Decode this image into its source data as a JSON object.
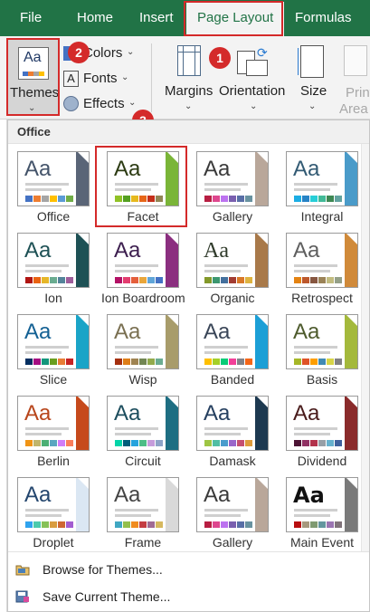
{
  "tabs": {
    "file": "File",
    "home": "Home",
    "insert": "Insert",
    "page_layout": "Page Layout",
    "formulas": "Formulas"
  },
  "ribbon": {
    "themes_label": "Themes",
    "colors_label": "Colors",
    "fonts_label": "Fonts",
    "effects_label": "Effects",
    "margins_label": "Margins",
    "orientation_label": "Orientation",
    "size_label": "Size",
    "print_label": "Print",
    "area_label": "Area",
    "themes_icon_text": "Aa"
  },
  "badges": {
    "one": "1",
    "two": "2",
    "three": "3"
  },
  "panel": {
    "section_title": "Office",
    "themes": [
      {
        "name": "Office",
        "aa_color": "#44546a",
        "aa_font": "sans",
        "accent": "#5a6577",
        "swatches": [
          "#4472c4",
          "#ed7d31",
          "#a5a5a5",
          "#ffc000",
          "#5b9bd5",
          "#70ad47"
        ]
      },
      {
        "name": "Facet",
        "aa_color": "#2c3b13",
        "aa_font": "sans",
        "accent": "#7ab538",
        "swatches": [
          "#90c226",
          "#54a021",
          "#e6b91e",
          "#e76618",
          "#c42f1a",
          "#918655"
        ]
      },
      {
        "name": "Gallery",
        "aa_color": "#3a3a3a",
        "aa_font": "sans",
        "accent": "#b9a79a",
        "swatches": [
          "#b71e42",
          "#de478e",
          "#bc72f0",
          "#795faf",
          "#586ea6",
          "#6892a0"
        ]
      },
      {
        "name": "Integral",
        "aa_color": "#335b74",
        "aa_font": "sans",
        "accent": "#4a9bc9",
        "swatches": [
          "#1cade4",
          "#2683c6",
          "#27ced7",
          "#42ba97",
          "#3e8853",
          "#62a39f"
        ]
      },
      {
        "name": "Ion",
        "aa_color": "#1e5155",
        "aa_font": "sans",
        "accent": "#1e5155",
        "swatches": [
          "#b01513",
          "#ea6312",
          "#e6b729",
          "#6aac90",
          "#54849a",
          "#9e5e9b"
        ]
      },
      {
        "name": "Ion Boardroom",
        "aa_color": "#3d1f4f",
        "aa_font": "sans",
        "accent": "#8b2f7f",
        "swatches": [
          "#b31166",
          "#e33d6f",
          "#e45f3c",
          "#e9a63b",
          "#60a5d8",
          "#4472c4"
        ]
      },
      {
        "name": "Organic",
        "aa_color": "#2f3a2a",
        "aa_font": "serif",
        "accent": "#a8794a",
        "swatches": [
          "#83992a",
          "#3c9770",
          "#44709d",
          "#a23c33",
          "#d97828",
          "#deb340"
        ]
      },
      {
        "name": "Retrospect",
        "aa_color": "#5f5f5f",
        "aa_font": "sans",
        "accent": "#d08a3a",
        "swatches": [
          "#e48312",
          "#bd582c",
          "#865640",
          "#9b8357",
          "#c2bc80",
          "#94a088"
        ]
      },
      {
        "name": "Slice",
        "aa_color": "#146194",
        "aa_font": "sans",
        "accent": "#1aa4c7",
        "swatches": [
          "#052f61",
          "#a50e82",
          "#14967c",
          "#6a9e1f",
          "#e87d37",
          "#c62324"
        ]
      },
      {
        "name": "Wisp",
        "aa_color": "#7a7052",
        "aa_font": "sans",
        "accent": "#a89c6b",
        "swatches": [
          "#a53010",
          "#de7e18",
          "#9f8351",
          "#728653",
          "#92aa4c",
          "#6aac91"
        ]
      },
      {
        "name": "Banded",
        "aa_color": "#3a4658",
        "aa_font": "sans",
        "accent": "#1c9fd6",
        "swatches": [
          "#ffc000",
          "#a5d028",
          "#08cc78",
          "#f24099",
          "#828288",
          "#f56617"
        ]
      },
      {
        "name": "Basis",
        "aa_color": "#4e5b2d",
        "aa_font": "sans",
        "accent": "#a4b93c",
        "swatches": [
          "#a6b727",
          "#df5327",
          "#fe9e00",
          "#418ab3",
          "#d7d447",
          "#818183"
        ]
      },
      {
        "name": "Berlin",
        "aa_color": "#b8461c",
        "aa_font": "sans",
        "accent": "#c64a1c",
        "swatches": [
          "#f09415",
          "#c1b56b",
          "#4baf73",
          "#5aa6c0",
          "#d17df9",
          "#fa7e5c"
        ]
      },
      {
        "name": "Circuit",
        "aa_color": "#1d4e5e",
        "aa_font": "sans",
        "accent": "#1e6e82",
        "swatches": [
          "#03d4a8",
          "#005e7a",
          "#26a3dd",
          "#4dbd86",
          "#c69cdb",
          "#8ea3c7"
        ]
      },
      {
        "name": "Damask",
        "aa_color": "#264060",
        "aa_font": "sans",
        "accent": "#1d3950",
        "swatches": [
          "#9ec544",
          "#50bea3",
          "#4a9ccc",
          "#9a66ca",
          "#c54f71",
          "#de9c3c"
        ]
      },
      {
        "name": "Dividend",
        "aa_color": "#4a1c1c",
        "aa_font": "sans",
        "accent": "#8a2b2b",
        "swatches": [
          "#4d1434",
          "#903163",
          "#b2324b",
          "#969fa7",
          "#66b1ce",
          "#40619d"
        ]
      },
      {
        "name": "Droplet",
        "aa_color": "#24466e",
        "aa_font": "sans",
        "accent": "#dbe7f3",
        "swatches": [
          "#2fa3ee",
          "#4bcaad",
          "#86c157",
          "#d99c3f",
          "#ce6633",
          "#a35dd1"
        ]
      },
      {
        "name": "Frame",
        "aa_color": "#444444",
        "aa_font": "sans",
        "accent": "#d9d9d9",
        "swatches": [
          "#40a7c2",
          "#93c04d",
          "#f08c1f",
          "#c43c42",
          "#a06b93",
          "#d6b85f"
        ]
      },
      {
        "name": "Gallery",
        "aa_color": "#3a3a3a",
        "aa_font": "sans",
        "accent": "#b9a79a",
        "swatches": [
          "#b71e42",
          "#de478e",
          "#bc72f0",
          "#795faf",
          "#586ea6",
          "#6892a0"
        ]
      },
      {
        "name": "Main Event",
        "aa_color": "#111111",
        "aa_font": "impact",
        "accent": "#7a7a7a",
        "swatches": [
          "#b80e0f",
          "#a6987d",
          "#7f9a71",
          "#64969f",
          "#9b75b2",
          "#80737a"
        ]
      }
    ],
    "browse_label": "Browse for Themes...",
    "save_label": "Save Current Theme..."
  },
  "colors": {
    "ribbon_green": "#217346",
    "callout_red": "#d42a2a"
  }
}
